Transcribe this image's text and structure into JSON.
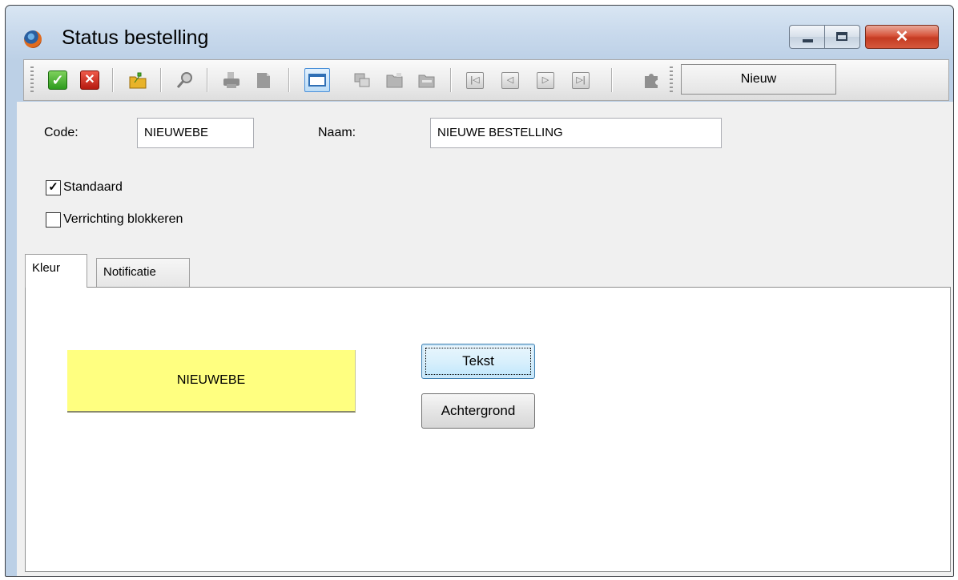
{
  "window": {
    "title": "Status bestelling",
    "minimize": "",
    "maximize": "",
    "close": "✕"
  },
  "toolbar": {
    "buttons": [
      {
        "name": "confirm",
        "icon": "check-icon",
        "color": "#2d9b1d"
      },
      {
        "name": "cancel",
        "icon": "close-icon",
        "color": "#b51a10"
      },
      {
        "name": "export",
        "icon": "folder-export-icon"
      },
      {
        "name": "search",
        "icon": "magnifier-icon"
      },
      {
        "name": "print",
        "icon": "printer-icon"
      },
      {
        "name": "document",
        "icon": "document-icon"
      },
      {
        "name": "form-view",
        "icon": "window-icon"
      },
      {
        "name": "copy",
        "icon": "copy-icon"
      },
      {
        "name": "open-folder",
        "icon": "folder-open-icon"
      },
      {
        "name": "closed-folder",
        "icon": "folder-icon"
      },
      {
        "name": "first",
        "icon": "first-record-icon"
      },
      {
        "name": "previous",
        "icon": "previous-record-icon"
      },
      {
        "name": "next",
        "icon": "next-record-icon"
      },
      {
        "name": "last",
        "icon": "last-record-icon"
      },
      {
        "name": "plugin",
        "icon": "puzzle-icon"
      }
    ],
    "state": "Nieuw"
  },
  "form": {
    "code_label": "Code:",
    "code_value": "NIEUWEBE",
    "name_label": "Naam:",
    "name_value": "NIEUWE BESTELLING",
    "standard_label": "Standaard",
    "standard_checked": true,
    "block_label": "Verrichting blokkeren",
    "block_checked": false
  },
  "tabs": [
    {
      "label": "Kleur",
      "active": true
    },
    {
      "label": "Notificatie",
      "active": false
    }
  ],
  "color_tab": {
    "preview_text": "NIEUWEBE",
    "preview_background": "#ffff80",
    "text_button": "Tekst",
    "background_button": "Achtergrond"
  }
}
